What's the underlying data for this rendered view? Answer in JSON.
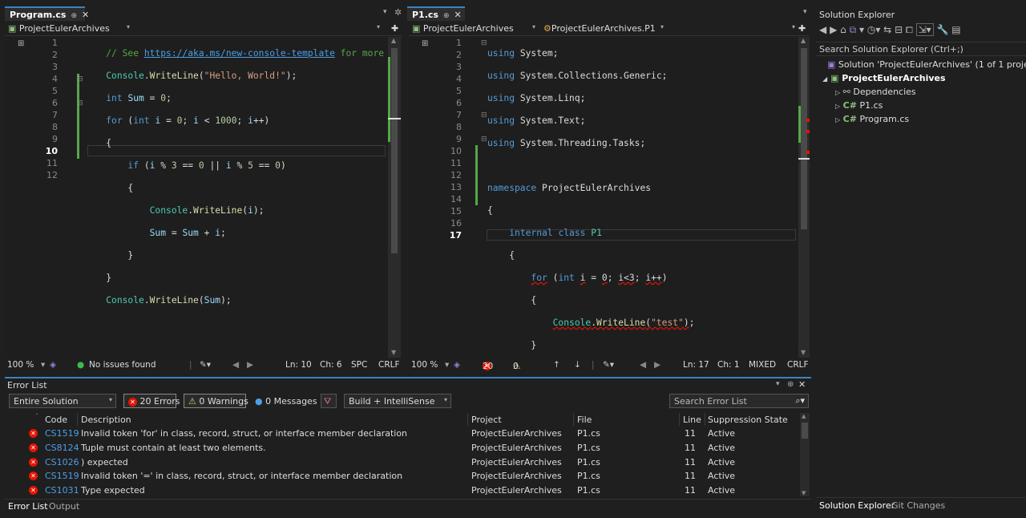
{
  "left_editor": {
    "tab_title": "Program.cs",
    "tab_pin": "⊕",
    "tab_close": "✕",
    "project_combo": "ProjectEulerArchives",
    "member_combo": "",
    "line_numbers": [
      "1",
      "2",
      "3",
      "4",
      "5",
      "6",
      "7",
      "8",
      "9",
      "10",
      "11",
      "12"
    ],
    "status": {
      "zoom": "100 %",
      "issues": "No issues found",
      "ln": "Ln: 10",
      "ch": "Ch: 6",
      "spc": "SPC",
      "crlf": "CRLF"
    }
  },
  "right_editor": {
    "tab_title": "P1.cs",
    "tab_pin": "⊕",
    "tab_close": "✕",
    "project_combo": "ProjectEulerArchives",
    "class_combo": "ProjectEulerArchives.P1",
    "line_numbers": [
      "1",
      "2",
      "3",
      "4",
      "5",
      "6",
      "7",
      "8",
      "9",
      "10",
      "11",
      "12",
      "13",
      "14",
      "15",
      "16",
      "17"
    ],
    "status": {
      "zoom": "100 %",
      "errors": "20",
      "warnings": "0",
      "ln": "Ln: 17",
      "ch": "Ch: 1",
      "mixed": "MIXED",
      "crlf": "CRLF"
    }
  },
  "error_list": {
    "title": "Error List",
    "scope": "Entire Solution",
    "errors_btn": "20 Errors",
    "warnings_btn": "0 Warnings",
    "messages_btn": "0 Messages",
    "build_combo": "Build + IntelliSense",
    "search_placeholder": "Search Error List",
    "columns": {
      "code": "Code",
      "description": "Description",
      "project": "Project",
      "file": "File",
      "line": "Line",
      "state": "Suppression State"
    },
    "rows": [
      {
        "code": "CS1519",
        "description": "Invalid token 'for' in class, record, struct, or interface member declaration",
        "project": "ProjectEulerArchives",
        "file": "P1.cs",
        "line": "11",
        "state": "Active"
      },
      {
        "code": "CS8124",
        "description": "Tuple must contain at least two elements.",
        "project": "ProjectEulerArchives",
        "file": "P1.cs",
        "line": "11",
        "state": "Active"
      },
      {
        "code": "CS1026",
        "description": ") expected",
        "project": "ProjectEulerArchives",
        "file": "P1.cs",
        "line": "11",
        "state": "Active"
      },
      {
        "code": "CS1519",
        "description": "Invalid token '=' in class, record, struct, or interface member declaration",
        "project": "ProjectEulerArchives",
        "file": "P1.cs",
        "line": "11",
        "state": "Active"
      },
      {
        "code": "CS1031",
        "description": "Type expected",
        "project": "ProjectEulerArchives",
        "file": "P1.cs",
        "line": "11",
        "state": "Active"
      }
    ],
    "bottom_tabs": [
      "Error List",
      "Output"
    ]
  },
  "solution_explorer": {
    "title": "Solution Explorer",
    "search_placeholder": "Search Solution Explorer (Ctrl+;)",
    "solution_label": "Solution 'ProjectEulerArchives' (1 of 1 project)",
    "project_label": "ProjectEulerArchives",
    "dependencies_label": "Dependencies",
    "files": [
      "P1.cs",
      "Program.cs"
    ],
    "cs_badge": "C#",
    "bottom_tabs": [
      "Solution Explorer",
      "Git Changes"
    ]
  },
  "colors": {
    "accent": "#3b82c4",
    "error": "#e51400",
    "keyword": "#569cd6",
    "type": "#4ec9b0",
    "string": "#d69d85",
    "comment": "#57a64a"
  }
}
